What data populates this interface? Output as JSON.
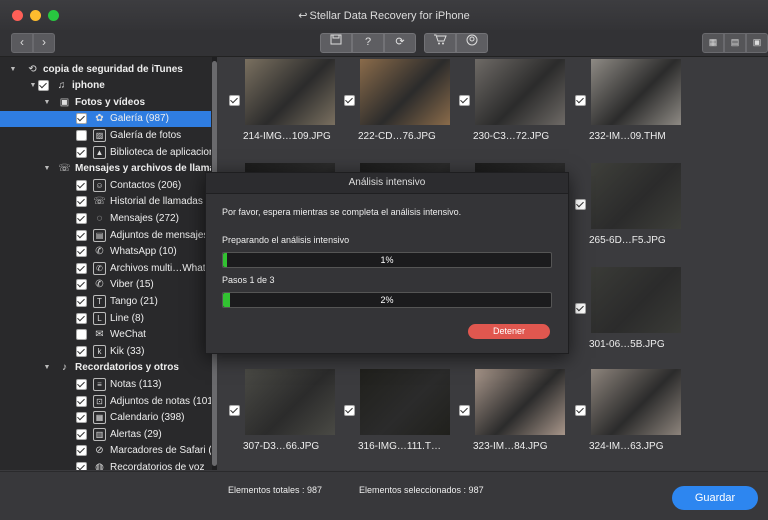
{
  "window": {
    "title": "Stellar Data Recovery for iPhone"
  },
  "toolbar": {
    "back_icon": "chevron-left-icon",
    "forward_icon": "chevron-right-icon",
    "save_icon": "save-icon",
    "help_label": "?",
    "refresh_icon": "refresh-icon",
    "cart_icon": "cart-icon",
    "account_icon": "account-icon",
    "view_icons": [
      "grid-view-icon",
      "list-view-icon",
      "preview-view-icon"
    ]
  },
  "sidebar": {
    "items": [
      {
        "label": "copia de seguridad de iTunes",
        "level": 0,
        "bold": true,
        "expand": "▼",
        "check": "none",
        "icon": "backup-icon"
      },
      {
        "label": "iphone",
        "level": 1,
        "bold": true,
        "expand": "▼",
        "check": "on",
        "icon": "music-note-icon"
      },
      {
        "label": "Fotos y vídeos",
        "level": 2,
        "bold": true,
        "expand": "▼",
        "check": "none",
        "icon": "photos-folder-icon"
      },
      {
        "label": "Galería (987)",
        "level": 3,
        "bold": false,
        "expand": "",
        "check": "on",
        "icon": "flower-icon",
        "selected": true
      },
      {
        "label": "Galería de fotos",
        "level": 3,
        "bold": false,
        "expand": "",
        "check": "off",
        "icon": "photo-gallery-icon"
      },
      {
        "label": "Biblioteca de aplicacion",
        "level": 3,
        "bold": false,
        "expand": "",
        "check": "on",
        "icon": "image-library-icon"
      },
      {
        "label": "Mensajes y archivos de llama",
        "level": 2,
        "bold": true,
        "expand": "▼",
        "check": "none",
        "icon": "phone-message-icon"
      },
      {
        "label": "Contactos (206)",
        "level": 3,
        "bold": false,
        "expand": "",
        "check": "on",
        "icon": "contacts-icon"
      },
      {
        "label": "Historial de llamadas (",
        "level": 3,
        "bold": false,
        "expand": "",
        "check": "on",
        "icon": "call-history-icon"
      },
      {
        "label": "Mensajes (272)",
        "level": 3,
        "bold": false,
        "expand": "",
        "check": "on",
        "icon": "message-bubble-icon"
      },
      {
        "label": "Adjuntos de mensajes",
        "level": 3,
        "bold": false,
        "expand": "",
        "check": "on",
        "icon": "attachment-icon"
      },
      {
        "label": "WhatsApp (10)",
        "level": 3,
        "bold": false,
        "expand": "",
        "check": "on",
        "icon": "whatsapp-icon"
      },
      {
        "label": "Archivos multi…What",
        "level": 3,
        "bold": false,
        "expand": "",
        "check": "on",
        "icon": "whatsapp-media-icon"
      },
      {
        "label": "Viber (15)",
        "level": 3,
        "bold": false,
        "expand": "",
        "check": "on",
        "icon": "viber-icon"
      },
      {
        "label": "Tango (21)",
        "level": 3,
        "bold": false,
        "expand": "",
        "check": "on",
        "icon": "tango-icon"
      },
      {
        "label": "Line (8)",
        "level": 3,
        "bold": false,
        "expand": "",
        "check": "on",
        "icon": "line-icon"
      },
      {
        "label": "WeChat",
        "level": 3,
        "bold": false,
        "expand": "",
        "check": "off",
        "icon": "wechat-icon"
      },
      {
        "label": "Kik (33)",
        "level": 3,
        "bold": false,
        "expand": "",
        "check": "on",
        "icon": "kik-icon"
      },
      {
        "label": "Recordatorios y otros",
        "level": 2,
        "bold": true,
        "expand": "▼",
        "check": "none",
        "icon": "microphone-icon"
      },
      {
        "label": "Notas (113)",
        "level": 3,
        "bold": false,
        "expand": "",
        "check": "on",
        "icon": "notes-icon"
      },
      {
        "label": "Adjuntos de notas (101",
        "level": 3,
        "bold": false,
        "expand": "",
        "check": "on",
        "icon": "notes-attachment-icon"
      },
      {
        "label": "Calendario (398)",
        "level": 3,
        "bold": false,
        "expand": "",
        "check": "on",
        "icon": "calendar-icon"
      },
      {
        "label": "Alertas (29)",
        "level": 3,
        "bold": false,
        "expand": "",
        "check": "on",
        "icon": "alerts-icon"
      },
      {
        "label": "Marcadores de Safari (",
        "level": 3,
        "bold": false,
        "expand": "",
        "check": "on",
        "icon": "safari-icon"
      },
      {
        "label": "Recordatorios de voz",
        "level": 3,
        "bold": false,
        "expand": "",
        "check": "on",
        "icon": "voice-memo-icon"
      }
    ]
  },
  "gallery": {
    "items": [
      {
        "name": "214-IMG…109.JPG",
        "color": "#7a7060"
      },
      {
        "name": "222-CD…76.JPG",
        "color": "#8a6b4a"
      },
      {
        "name": "230-C3…72.JPG",
        "color": "#6e6a66"
      },
      {
        "name": "232-IM…09.THM",
        "color": "#8e8a84"
      },
      {
        "name": "",
        "color": "#1c1c1c"
      },
      {
        "name": "",
        "color": "#1c1c1c"
      },
      {
        "name": "",
        "color": "#1c1c1c"
      },
      {
        "name": "265-6D…F5.JPG",
        "color": "#3e3f3a"
      },
      {
        "name": "",
        "color": "#1c1c1c"
      },
      {
        "name": "",
        "color": "#1c1c1c"
      },
      {
        "name": "",
        "color": "#1c1c1c"
      },
      {
        "name": "301-06…5B.JPG",
        "color": "#3a3b37"
      },
      {
        "name": "307-D3…66.JPG",
        "color": "#4a4a45"
      },
      {
        "name": "316-IMG…111.T…",
        "color": "#20201c"
      },
      {
        "name": "323-IM…84.JPG",
        "color": "#a8968a"
      },
      {
        "name": "324-IM…63.JPG",
        "color": "#8d847c"
      }
    ]
  },
  "status": {
    "total_label": "Elementos totales : 987",
    "selected_label": "Elementos seleccionados : 987",
    "save_label": "Guardar"
  },
  "dialog": {
    "title": "Análisis intensivo",
    "message": "Por favor, espera mientras se completa el análisis intensivo.",
    "step1_label": "Preparando el análisis intensivo",
    "step1_percent": "1%",
    "step1_value": 0.01,
    "step2_label": "Pasos 1 de 3",
    "step2_percent": "2%",
    "step2_value": 0.02,
    "stop_label": "Detener"
  },
  "colors": {
    "accent": "#2d86f0",
    "selected_row": "#2f7de1",
    "progress": "#32c232",
    "stop": "#e0574f"
  }
}
